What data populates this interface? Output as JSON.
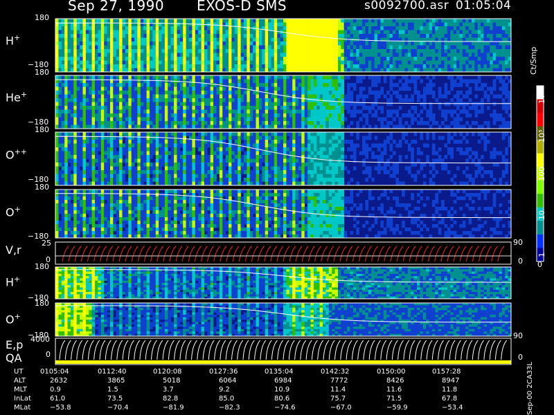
{
  "header": {
    "date": "Sep 27, 1990",
    "instrument": "EXOS-D SMS",
    "file": "s0092700.asr",
    "time": "01:05:04"
  },
  "colorbar": {
    "unit_label": "Ct/Smp",
    "ticks": [
      "10⁴",
      "10³",
      "100",
      "10",
      "1",
      "0"
    ],
    "colors": [
      "#ffffff",
      "#d00000",
      "#ff0000",
      "#606000",
      "#b0b000",
      "#ffff00",
      "#c8ff00",
      "#80ff00",
      "#30c000",
      "#00c8c8",
      "#009090",
      "#0030ff",
      "#0000a0"
    ]
  },
  "panels": [
    {
      "ion": "H",
      "charge": "+",
      "top_tick": "180",
      "bottom_tick": "−180"
    },
    {
      "ion": "He",
      "charge": "+",
      "top_tick": "180",
      "bottom_tick": "−180"
    },
    {
      "ion": "O",
      "charge": "++",
      "top_tick": "180",
      "bottom_tick": "−180"
    },
    {
      "ion": "O",
      "charge": "+",
      "top_tick": "180",
      "bottom_tick": "−180"
    }
  ],
  "vr_panel": {
    "label": "V,r",
    "left_ticks": [
      "25",
      "0"
    ],
    "right_ticks": [
      "90",
      "0"
    ]
  },
  "lower_panels": [
    {
      "ion": "H",
      "charge": "+",
      "top_tick": "180",
      "bottom_tick": "−180"
    },
    {
      "ion": "O",
      "charge": "+",
      "top_tick": "180",
      "bottom_tick": "−180"
    }
  ],
  "ep_panel": {
    "label1": "E,p",
    "label2": "QA",
    "left_ticks": [
      "4000",
      "0"
    ],
    "right_ticks": [
      "90",
      "0"
    ]
  },
  "footer_note": "Sep-00 2CA33L",
  "chart_data": {
    "type": "heatmap",
    "title": "",
    "xlabel": "UT",
    "ylabel": "",
    "ylim": [
      -180,
      180
    ],
    "x": [
      "0105:04",
      "0112:40",
      "0120:08",
      "0127:36",
      "0135:04",
      "0142:32",
      "0150:00",
      "0157:28"
    ],
    "series": [
      {
        "name": "ALT",
        "values": [
          2632,
          3865,
          5018,
          6064,
          6984,
          7772,
          8426,
          8947
        ]
      },
      {
        "name": "MLT",
        "values": [
          0.9,
          1.5,
          3.7,
          9.2,
          10.9,
          11.4,
          11.6,
          11.8
        ]
      },
      {
        "name": "InLat",
        "values": [
          61.0,
          73.5,
          82.8,
          85.0,
          80.6,
          75.7,
          71.5,
          67.8
        ]
      },
      {
        "name": "MLat",
        "values": [
          -53.8,
          -70.4,
          -81.9,
          -82.3,
          -74.6,
          -67.0,
          -59.9,
          -53.4
        ]
      }
    ],
    "ephemeris_display": {
      "row_labels": [
        "UT",
        "ALT",
        "MLT",
        "InLat",
        "MLat"
      ],
      "UT": [
        "0105:04",
        "0112:40",
        "0120:08",
        "0127:36",
        "0135:04",
        "0142:32",
        "0150:00",
        "0157:28"
      ],
      "ALT": [
        "2632",
        "3865",
        "5018",
        "6064",
        "6984",
        "7772",
        "8426",
        "8947"
      ],
      "MLT": [
        "0.9",
        "1.5",
        "3.7",
        "9.2",
        "10.9",
        "11.4",
        "11.6",
        "11.8"
      ],
      "InLat": [
        "61.0",
        "73.5",
        "82.8",
        "85.0",
        "80.6",
        "75.7",
        "71.5",
        "67.8"
      ],
      "MLat": [
        "−53.8",
        "−70.4",
        "−81.9",
        "−82.3",
        "−74.6",
        "−67.0",
        "−59.9",
        "−53.4"
      ]
    }
  }
}
